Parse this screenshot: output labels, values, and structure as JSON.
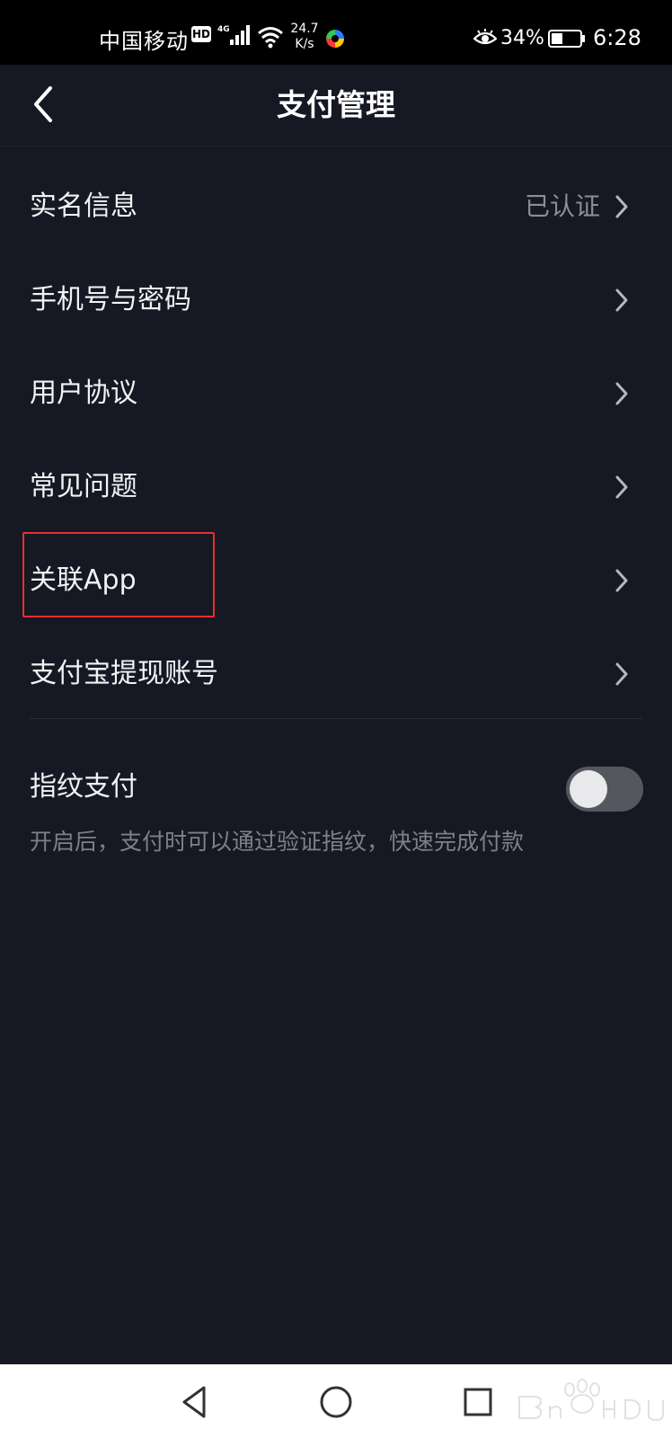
{
  "status_bar": {
    "carrier": "中国移动",
    "hd_badge": "HD",
    "net_speed_value": "24.7",
    "net_speed_unit": "K/s",
    "battery_percent": "34%",
    "time": "6:28"
  },
  "header": {
    "title": "支付管理",
    "back_icon": "chevron-left-icon"
  },
  "menu": {
    "items": [
      {
        "label": "实名信息",
        "value": "已认证"
      },
      {
        "label": "手机号与密码",
        "value": ""
      },
      {
        "label": "用户协议",
        "value": ""
      },
      {
        "label": "常见问题",
        "value": ""
      },
      {
        "label": "关联App",
        "value": ""
      },
      {
        "label": "支付宝提现账号",
        "value": ""
      }
    ],
    "highlighted_item": "关联App"
  },
  "fingerprint": {
    "label": "指纹支付",
    "enabled": false,
    "description": "开启后，支付时可以通过验证指纹，快速完成付款"
  },
  "system_nav": {
    "back": "triangle-back-icon",
    "home": "circle-home-icon",
    "recents": "square-recents-icon"
  },
  "colors": {
    "background": "#161823",
    "highlight": "#e8302e",
    "secondary_text": "#8d8e93"
  }
}
